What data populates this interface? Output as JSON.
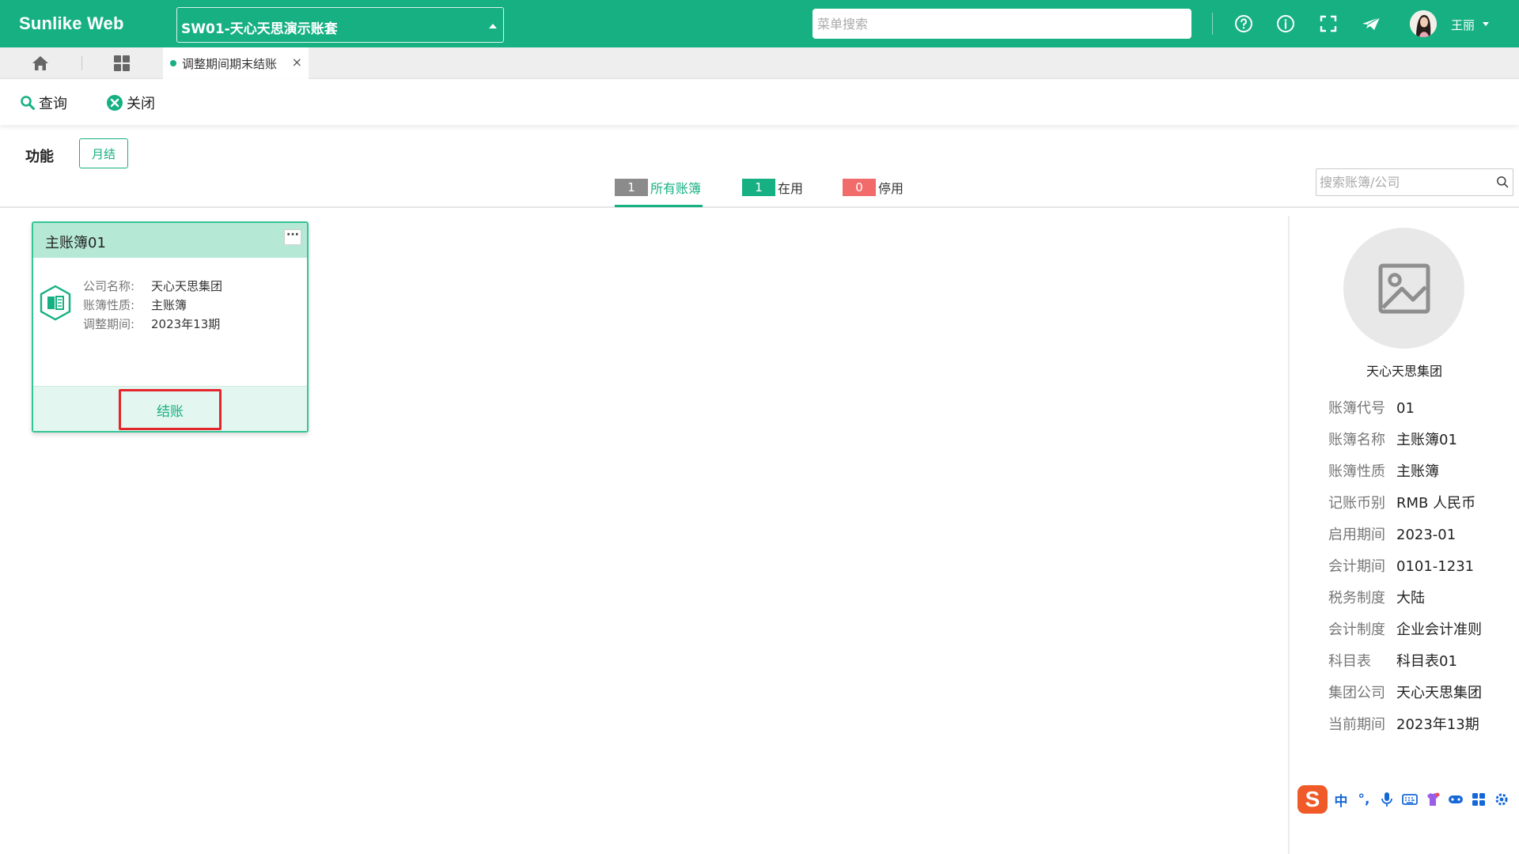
{
  "app": {
    "logo": "Sunlike Web",
    "account_selector": "SW01-天心天思演示账套",
    "search_placeholder": "菜单搜索",
    "user_name": "王丽"
  },
  "tabs": {
    "active_tab": "调整期间期末结账",
    "close_glyph": "×"
  },
  "toolbar": {
    "query": "查询",
    "close": "关闭"
  },
  "function": {
    "label": "功能",
    "month_close": "月结"
  },
  "filters": [
    {
      "count": "1",
      "label": "所有账簿",
      "color": "#8b8b8b"
    },
    {
      "count": "1",
      "label": "在用",
      "color": "#17b083"
    },
    {
      "count": "0",
      "label": "停用",
      "color": "#f26b6b"
    }
  ],
  "book_search_placeholder": "搜索账簿/公司",
  "card": {
    "title": "主账簿01",
    "more": "···",
    "rows": [
      {
        "k": "公司名称:",
        "v": "天心天思集团"
      },
      {
        "k": "账簿性质:",
        "v": "主账簿"
      },
      {
        "k": "调整期间:",
        "v": "2023年13期"
      }
    ],
    "close_button": "结账"
  },
  "detail": {
    "company_name": "天心天思集团",
    "rows": [
      {
        "k": "账簿代号",
        "v": "01"
      },
      {
        "k": "账簿名称",
        "v": "主账簿01"
      },
      {
        "k": "账簿性质",
        "v": "主账簿"
      },
      {
        "k": "记账币别",
        "v": "RMB 人民币"
      },
      {
        "k": "启用期间",
        "v": "2023-01"
      },
      {
        "k": "会计期间",
        "v": "0101-1231"
      },
      {
        "k": "税务制度",
        "v": "大陆"
      },
      {
        "k": "会计制度",
        "v": "企业会计准则"
      },
      {
        "k": "科目表",
        "v": "科目表01"
      },
      {
        "k": "集团公司",
        "v": "天心天思集团"
      },
      {
        "k": "当前期间",
        "v": "2023年13期"
      }
    ]
  },
  "ime": {
    "logo": "S",
    "lang": "中",
    "punct": "°,"
  },
  "colors": {
    "brand": "#17b083",
    "card_header": "#b6e8d6",
    "highlight": "#e3262b"
  }
}
